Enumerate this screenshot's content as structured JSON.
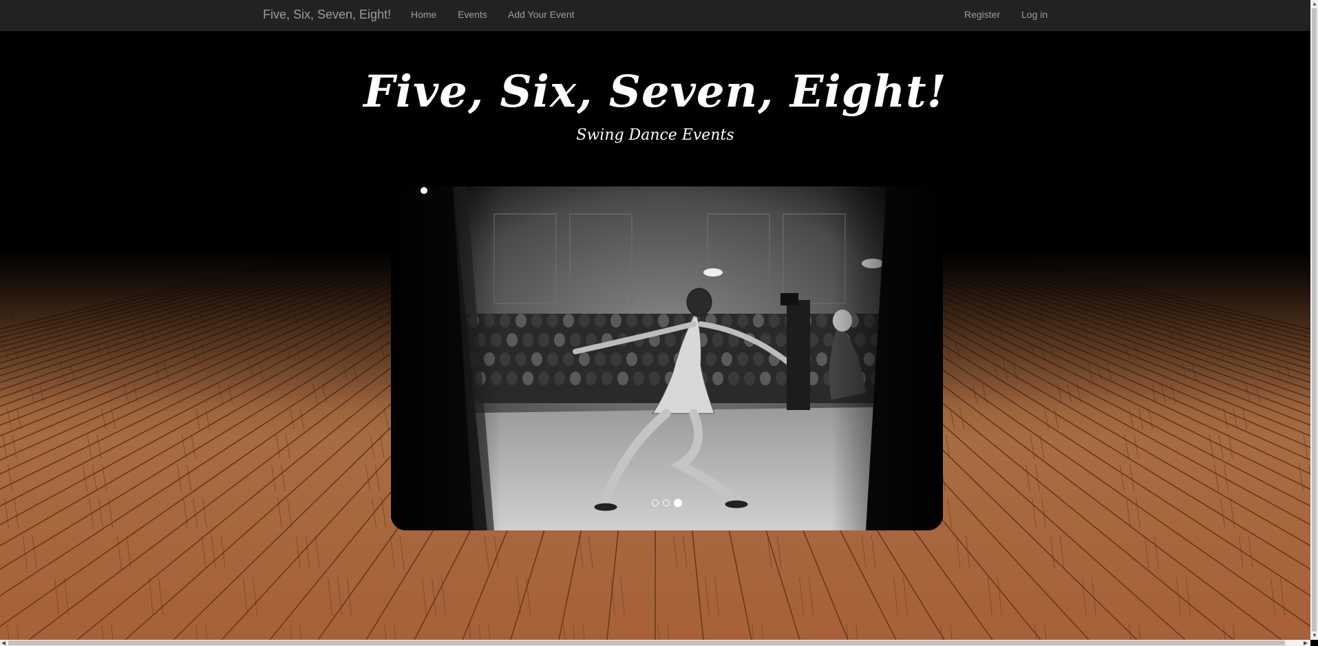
{
  "navbar": {
    "brand": "Five, Six, Seven, Eight!",
    "left_links": [
      "Home",
      "Events",
      "Add Your Event"
    ],
    "right_links": [
      "Register",
      "Log in"
    ]
  },
  "header": {
    "title": "Five, Six, Seven, Eight!",
    "subtitle": "Swing Dance Events"
  },
  "carousel": {
    "slide_count": 3,
    "active_index": 2,
    "image_description": "black and white photo of a swing dancer performing in a ballroom in front of an audience"
  },
  "colors": {
    "navbar_bg": "#222222",
    "nav_text": "#9d9d9d",
    "floor_wood": "#b8734a",
    "page_bg": "#000000"
  }
}
